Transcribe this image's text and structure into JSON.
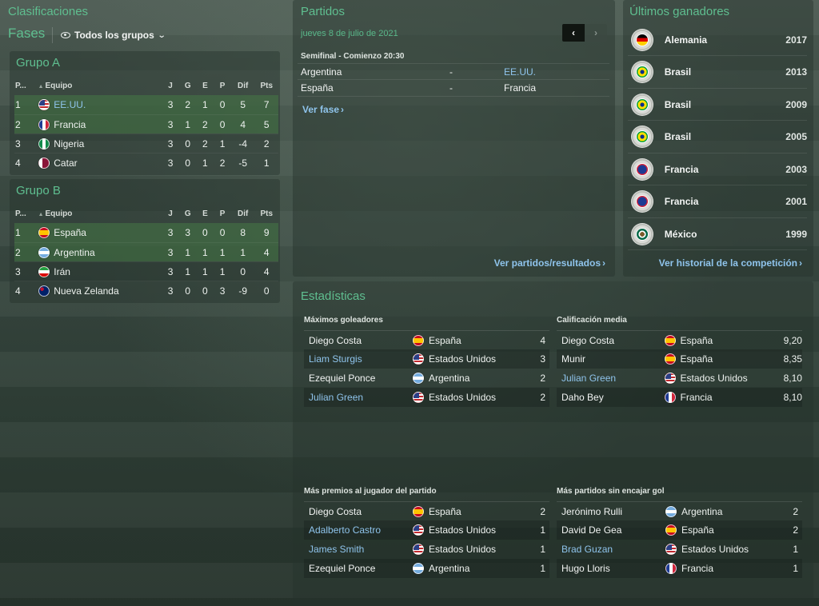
{
  "clasificaciones": {
    "title": "Clasificaciones",
    "fases_label": "Fases",
    "filter_label": "Todos los grupos",
    "columns": [
      "P...",
      "Equipo",
      "J",
      "G",
      "E",
      "P",
      "Dif",
      "Pts"
    ],
    "groups": [
      {
        "name": "Grupo A",
        "rows": [
          {
            "pos": "1",
            "team": "EE.UU.",
            "flag": "f-usa",
            "j": "3",
            "g": "2",
            "e": "1",
            "p": "0",
            "dif": "5",
            "pts": "7",
            "qualified": true,
            "link": true
          },
          {
            "pos": "2",
            "team": "Francia",
            "flag": "f-fra",
            "j": "3",
            "g": "1",
            "e": "2",
            "p": "0",
            "dif": "4",
            "pts": "5",
            "qualified": true,
            "link": false
          },
          {
            "pos": "3",
            "team": "Nigeria",
            "flag": "f-nga",
            "j": "3",
            "g": "0",
            "e": "2",
            "p": "1",
            "dif": "-4",
            "pts": "2",
            "qualified": false,
            "link": false
          },
          {
            "pos": "4",
            "team": "Catar",
            "flag": "f-qat",
            "j": "3",
            "g": "0",
            "e": "1",
            "p": "2",
            "dif": "-5",
            "pts": "1",
            "qualified": false,
            "link": false
          }
        ]
      },
      {
        "name": "Grupo B",
        "rows": [
          {
            "pos": "1",
            "team": "España",
            "flag": "f-esp",
            "j": "3",
            "g": "3",
            "e": "0",
            "p": "0",
            "dif": "8",
            "pts": "9",
            "qualified": true,
            "link": false
          },
          {
            "pos": "2",
            "team": "Argentina",
            "flag": "f-arg",
            "j": "3",
            "g": "1",
            "e": "1",
            "p": "1",
            "dif": "1",
            "pts": "4",
            "qualified": true,
            "link": false
          },
          {
            "pos": "3",
            "team": "Irán",
            "flag": "f-irn",
            "j": "3",
            "g": "1",
            "e": "1",
            "p": "1",
            "dif": "0",
            "pts": "4",
            "qualified": false,
            "link": false
          },
          {
            "pos": "4",
            "team": "Nueva Zelanda",
            "flag": "f-nzl",
            "j": "3",
            "g": "0",
            "e": "0",
            "p": "3",
            "dif": "-9",
            "pts": "0",
            "qualified": false,
            "link": false
          }
        ]
      }
    ]
  },
  "partidos": {
    "title": "Partidos",
    "date": "jueves 8 de julio de 2021",
    "pager_prev": "‹",
    "pager_next": "›",
    "round": "Semifinal - Comienzo 20:30",
    "matches": [
      {
        "home": "Argentina",
        "sep": "-",
        "away": "EE.UU.",
        "away_link": true
      },
      {
        "home": "España",
        "sep": "-",
        "away": "Francia",
        "away_link": false
      }
    ],
    "ver_fase": "Ver fase",
    "ver_partidos": "Ver partidos/resultados"
  },
  "ganadores": {
    "title": "Últimos ganadores",
    "items": [
      {
        "team": "Alemania",
        "year": "2017",
        "crest": "ci-ger"
      },
      {
        "team": "Brasil",
        "year": "2013",
        "crest": "ci-bra"
      },
      {
        "team": "Brasil",
        "year": "2009",
        "crest": "ci-bra"
      },
      {
        "team": "Brasil",
        "year": "2005",
        "crest": "ci-bra"
      },
      {
        "team": "Francia",
        "year": "2003",
        "crest": "ci-fra"
      },
      {
        "team": "Francia",
        "year": "2001",
        "crest": "ci-fra"
      },
      {
        "team": "México",
        "year": "1999",
        "crest": "ci-mex"
      }
    ],
    "ver_historial": "Ver historial de la competición"
  },
  "estadisticas": {
    "title": "Estadísticas",
    "tables": [
      {
        "title": "Máximos goleadores",
        "rows": [
          {
            "player": "Diego Costa",
            "link": false,
            "team": "España",
            "flag": "f-esp",
            "value": "4"
          },
          {
            "player": "Liam Sturgis",
            "link": true,
            "team": "Estados Unidos",
            "flag": "f-usa",
            "value": "3"
          },
          {
            "player": "Ezequiel Ponce",
            "link": false,
            "team": "Argentina",
            "flag": "f-arg",
            "value": "2"
          },
          {
            "player": "Julian Green",
            "link": true,
            "team": "Estados Unidos",
            "flag": "f-usa",
            "value": "2"
          }
        ]
      },
      {
        "title": "Calificación media",
        "rows": [
          {
            "player": "Diego Costa",
            "link": false,
            "team": "España",
            "flag": "f-esp",
            "value": "9,20"
          },
          {
            "player": "Munir",
            "link": false,
            "team": "España",
            "flag": "f-esp",
            "value": "8,35"
          },
          {
            "player": "Julian Green",
            "link": true,
            "team": "Estados Unidos",
            "flag": "f-usa",
            "value": "8,10"
          },
          {
            "player": "Daho Bey",
            "link": false,
            "team": "Francia",
            "flag": "f-fra",
            "value": "8,10"
          }
        ]
      },
      {
        "title": "Más premios al jugador del partido",
        "rows": [
          {
            "player": "Diego Costa",
            "link": false,
            "team": "España",
            "flag": "f-esp",
            "value": "2"
          },
          {
            "player": "Adalberto Castro",
            "link": true,
            "team": "Estados Unidos",
            "flag": "f-usa",
            "value": "1"
          },
          {
            "player": "James Smith",
            "link": true,
            "team": "Estados Unidos",
            "flag": "f-usa",
            "value": "1"
          },
          {
            "player": "Ezequiel Ponce",
            "link": false,
            "team": "Argentina",
            "flag": "f-arg",
            "value": "1"
          }
        ]
      },
      {
        "title": "Más partidos sin encajar gol",
        "rows": [
          {
            "player": "Jerónimo Rulli",
            "link": false,
            "team": "Argentina",
            "flag": "f-arg",
            "value": "2"
          },
          {
            "player": "David De Gea",
            "link": false,
            "team": "España",
            "flag": "f-esp",
            "value": "2"
          },
          {
            "player": "Brad Guzan",
            "link": true,
            "team": "Estados Unidos",
            "flag": "f-usa",
            "value": "1"
          },
          {
            "player": "Hugo Lloris",
            "link": false,
            "team": "Francia",
            "flag": "f-fra",
            "value": "1"
          }
        ]
      }
    ]
  }
}
